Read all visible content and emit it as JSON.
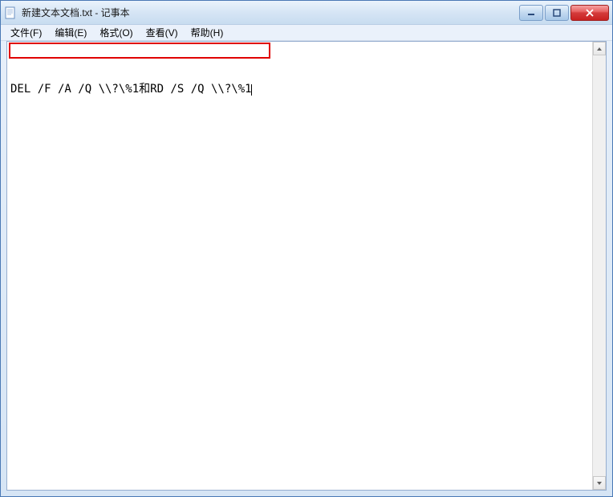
{
  "titlebar": {
    "title": "新建文本文档.txt - 记事本"
  },
  "menubar": {
    "items": [
      {
        "label": "文件(F)"
      },
      {
        "label": "编辑(E)"
      },
      {
        "label": "格式(O)"
      },
      {
        "label": "查看(V)"
      },
      {
        "label": "帮助(H)"
      }
    ]
  },
  "editor": {
    "content": "DEL /F /A /Q \\\\?\\%1和RD /S /Q \\\\?\\%1"
  }
}
